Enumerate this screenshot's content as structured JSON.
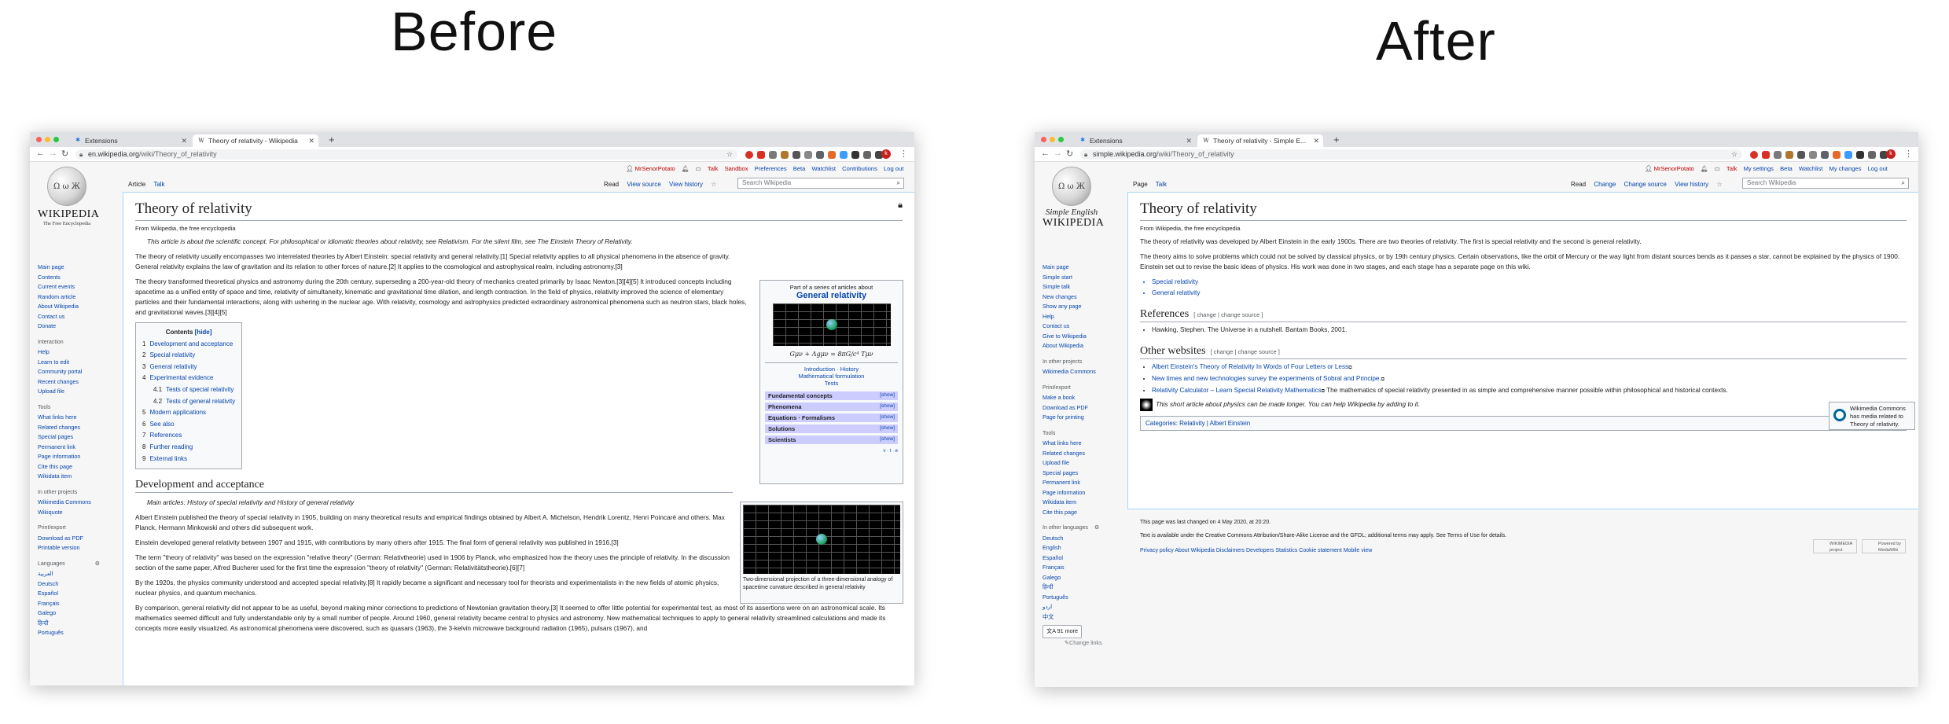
{
  "captions": {
    "before": "Before",
    "after": "After"
  },
  "before": {
    "tabs": [
      {
        "label": "Extensions"
      },
      {
        "label": "Theory of relativity - Wikipedia"
      }
    ],
    "url": {
      "host": "en.wikipedia.org",
      "path": "/wiki/Theory_of_relativity"
    },
    "personal": [
      "MrSenorPotato",
      "Talk",
      "Sandbox",
      "Preferences",
      "Beta",
      "Watchlist",
      "Contributions",
      "Log out"
    ],
    "logo": {
      "wordmark": "WIKIPEDIA",
      "tagline": "The Free Encyclopedia"
    },
    "page_tabs": [
      "Article",
      "Talk"
    ],
    "view_tabs": [
      "Read",
      "View source",
      "View history"
    ],
    "search_placeholder": "Search Wikipedia",
    "sidebar": {
      "main": [
        "Main page",
        "Contents",
        "Current events",
        "Random article",
        "About Wikipedia",
        "Contact us",
        "Donate"
      ],
      "interaction_title": "Interaction",
      "interaction": [
        "Help",
        "Learn to edit",
        "Community portal",
        "Recent changes",
        "Upload file"
      ],
      "tools_title": "Tools",
      "tools": [
        "What links here",
        "Related changes",
        "Special pages",
        "Permanent link",
        "Page information",
        "Cite this page",
        "Wikidata item"
      ],
      "projects_title": "In other projects",
      "projects": [
        "Wikimedia Commons",
        "Wikiquote"
      ],
      "print_title": "Print/export",
      "print": [
        "Download as PDF",
        "Printable version"
      ],
      "lang_title": "Languages",
      "langs": [
        "العربية",
        "Deutsch",
        "Español",
        "Français",
        "Galego",
        "हिन्दी",
        "Português"
      ]
    },
    "title": "Theory of relativity",
    "from": "From Wikipedia, the free encyclopedia",
    "hatnote": "This article is about the scientific concept. For philosophical or idiomatic theories about relativity, see Relativism. For the silent film, see The Einstein Theory of Relativity.",
    "paragraphs": [
      "The theory of relativity usually encompasses two interrelated theories by Albert Einstein: special relativity and general relativity.[1] Special relativity applies to all physical phenomena in the absence of gravity. General relativity explains the law of gravitation and its relation to other forces of nature.[2] It applies to the cosmological and astrophysical realm, including astronomy.[3]",
      "The theory transformed theoretical physics and astronomy during the 20th century, superseding a 200-year-old theory of mechanics created primarily by Isaac Newton.[3][4][5] It introduced concepts including spacetime as a unified entity of space and time, relativity of simultaneity, kinematic and gravitational time dilation, and length contraction. In the field of physics, relativity improved the science of elementary particles and their fundamental interactions, along with ushering in the nuclear age. With relativity, cosmology and astrophysics predicted extraordinary astronomical phenomena such as neutron stars, black holes, and gravitational waves.[3][4][5]"
    ],
    "toc": {
      "title": "Contents",
      "hide": "[hide]",
      "items": [
        {
          "n": "1",
          "t": "Development and acceptance"
        },
        {
          "n": "2",
          "t": "Special relativity"
        },
        {
          "n": "3",
          "t": "General relativity"
        },
        {
          "n": "4",
          "t": "Experimental evidence"
        },
        {
          "n": "4.1",
          "t": "Tests of special relativity"
        },
        {
          "n": "4.2",
          "t": "Tests of general relativity"
        },
        {
          "n": "5",
          "t": "Modern applications"
        },
        {
          "n": "6",
          "t": "See also"
        },
        {
          "n": "7",
          "t": "References"
        },
        {
          "n": "8",
          "t": "Further reading"
        },
        {
          "n": "9",
          "t": "External links"
        }
      ]
    },
    "infobox": {
      "series": "Part of a series of articles about",
      "heading": "General relativity",
      "equation": "Gμν + Λgμν = 8πG/c⁴ Tμν",
      "links": [
        "Introduction · History",
        "Mathematical formulation",
        "Tests"
      ],
      "rows": [
        {
          "label": "Fundamental concepts",
          "action": "[show]"
        },
        {
          "label": "Phenomena",
          "action": "[show]"
        },
        {
          "label": "Equations · Formalisms",
          "action": "[show]"
        },
        {
          "label": "Solutions",
          "action": "[show]"
        },
        {
          "label": "Scientists",
          "action": "[show]"
        }
      ],
      "vte": "v · t · e"
    },
    "image_caption": "Two-dimensional projection of a three-dimensional analogy of spacetime curvature described in general relativity",
    "section_title": "Development and acceptance",
    "main_articles": "Main articles: History of special relativity and History of general relativity",
    "section_paragraphs": [
      "Albert Einstein published the theory of special relativity in 1905, building on many theoretical results and empirical findings obtained by Albert A. Michelson, Hendrik Lorentz, Henri Poincaré and others. Max Planck, Hermann Minkowski and others did subsequent work.",
      "Einstein developed general relativity between 1907 and 1915, with contributions by many others after 1915. The final form of general relativity was published in 1916.[3]",
      "The term \"theory of relativity\" was based on the expression \"relative theory\" (German: Relativtheorie) used in 1906 by Planck, who emphasized how the theory uses the principle of relativity. In the discussion section of the same paper, Alfred Bucherer used for the first time the expression \"theory of relativity\" (German: Relativitätstheorie).[6][7]",
      "By the 1920s, the physics community understood and accepted special relativity.[8] It rapidly became a significant and necessary tool for theorists and experimentalists in the new fields of atomic physics, nuclear physics, and quantum mechanics.",
      "By comparison, general relativity did not appear to be as useful, beyond making minor corrections to predictions of Newtonian gravitation theory.[3] It seemed to offer little potential for experimental test, as most of its assertions were on an astronomical scale. Its mathematics seemed difficult and fully understandable only by a small number of people. Around 1960, general relativity became central to physics and astronomy. New mathematical techniques to apply to general relativity streamlined calculations and made its concepts more easily visualized. As astronomical phenomena were discovered, such as quasars (1963), the 3-kelvin microwave background radiation (1965), pulsars (1967), and"
    ]
  },
  "after": {
    "tabs": [
      {
        "label": "Extensions"
      },
      {
        "label": "Theory of relativity - Simple E..."
      }
    ],
    "url": {
      "host": "simple.wikipedia.org",
      "path": "/wiki/Theory_of_relativity"
    },
    "personal": [
      "MrSenorPotato",
      "Talk",
      "My settings",
      "Beta",
      "Watchlist",
      "My changes",
      "Log out"
    ],
    "logo": {
      "wordmark1": "Simple English",
      "wordmark2": "WIKIPEDIA"
    },
    "page_tabs": [
      "Page",
      "Talk"
    ],
    "view_tabs": [
      "Read",
      "Change",
      "Change source",
      "View history"
    ],
    "search_placeholder": "Search Wikipedia",
    "sidebar": {
      "main": [
        "Main page",
        "Simple start",
        "Simple talk",
        "New changes",
        "Show any page",
        "Help",
        "Contact us",
        "Give to Wikipedia",
        "About Wikipedia"
      ],
      "projects_title": "In other projects",
      "projects": [
        "Wikimedia Commons"
      ],
      "print_title": "Print/export",
      "print": [
        "Make a book",
        "Download as PDF",
        "Page for printing"
      ],
      "tools_title": "Tools",
      "tools": [
        "What links here",
        "Related changes",
        "Upload file",
        "Special pages",
        "Permanent link",
        "Page information",
        "Wikidata item",
        "Cite this page"
      ],
      "lang_title": "In other languages",
      "langs": [
        "Deutsch",
        "English",
        "Español",
        "Français",
        "Galego",
        "हिन्दी",
        "Português",
        "اردو",
        "中文"
      ],
      "more": "91 more",
      "change_links": "Change links"
    },
    "title": "Theory of relativity",
    "from": "From Wikipedia, the free encyclopedia",
    "paragraphs": [
      "The theory of relativity was developed by Albert Einstein in the early 1900s. There are two theories of relativity. The first is special relativity and the second is general relativity.",
      "The theory aims to solve problems which could not be solved by classical physics, or by 19th century physics. Certain observations, like the orbit of Mercury or the way light from distant sources bends as it passes a star, cannot be explained by the physics of 1900. Einstein set out to revise the basic ideas of physics. His work was done in two stages, and each stage has a separate page on this wiki."
    ],
    "bullets": [
      "Special relativity",
      "General relativity"
    ],
    "references_title": "References",
    "edit_links": "[ change | change source ]",
    "reference": "Hawking, Stephen. The Universe in a nutshell. Bantam Books, 2001.",
    "other_title": "Other websites",
    "external": [
      {
        "link": "Albert Einstein's Theory of Relativity In Words of Four Letters or Less",
        "desc": ""
      },
      {
        "link": "New times and new technologies survey the experiments of Sobral and Principe.",
        "desc": ""
      },
      {
        "link": "Relativity Calculator – Learn Special Relativity Mathematics",
        "desc": " The mathematics of special relativity presented in as simple and comprehensive manner possible within philosophical and historical contexts."
      }
    ],
    "commons": "Wikimedia Commons has media related to Theory of relativity.",
    "stub": "This short article about physics can be made longer. You can help Wikipedia by adding to it.",
    "categories": "Categories:  Relativity  |  Albert Einstein",
    "footer": [
      "This page was last changed on 4 May 2020, at 20:20.",
      "Text is available under the Creative Commons Attribution/Share-Alike License and the GFDL; additional terms may apply. See Terms of Use for details.",
      "Privacy policy   About Wikipedia   Disclaimers   Developers   Statistics   Cookie statement   Mobile view"
    ],
    "badges": [
      "WIKIMEDIA project",
      "Powered by MediaWiki"
    ]
  }
}
